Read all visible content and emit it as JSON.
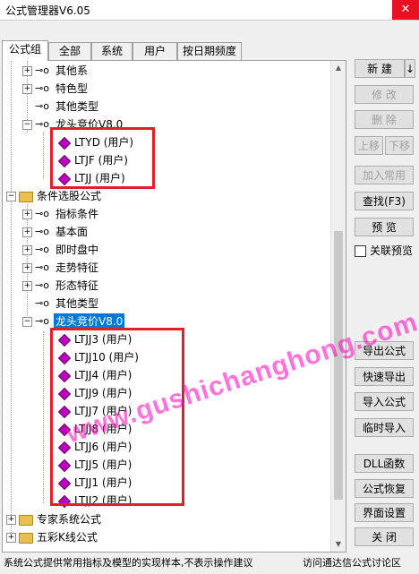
{
  "window": {
    "title": "公式管理器V6.05",
    "close": "✕"
  },
  "tabs": [
    "公式组",
    "全部",
    "系统",
    "用户",
    "按日期频度"
  ],
  "tree": {
    "top_items": [
      "其他系",
      "特色型",
      "其他类型",
      "龙头竞价V8.0"
    ],
    "group1_children": [
      "LTYD  (用户)",
      "LTJF  (用户)",
      "LTJJ  (用户)"
    ],
    "folder_condition": "条件选股公式",
    "condition_items": [
      "指标条件",
      "基本面",
      "即时盘中",
      "走势特征",
      "形态特征",
      "其他类型",
      "龙头竞价V8.0"
    ],
    "group2_children": [
      "LTJJ3  (用户)",
      "LTJJ10  (用户)",
      "LTJJ4  (用户)",
      "LTJJ9  (用户)",
      "LTJJ7  (用户)",
      "LTJJ8  (用户)",
      "LTJJ6  (用户)",
      "LTJJ5  (用户)",
      "LTJJ1  (用户)",
      "LTJJ2  (用户)"
    ],
    "folder_expert": "专家系统公式",
    "folder_kline": "五彩K线公式"
  },
  "buttons": {
    "new": "新 建",
    "new_arrow": "↓",
    "modify": "修 改",
    "delete": "删 除",
    "up": "上移",
    "down": "下移",
    "add_common": "加入常用",
    "find": "查找(F3)",
    "preview": "预 览",
    "link_preview": "关联预览",
    "export": "导出公式",
    "quick_export": "快速导出",
    "import": "导入公式",
    "temp_import": "临时导入",
    "dll": "DLL函数",
    "restore": "公式恢复",
    "ui_settings": "界面设置",
    "close": "关 闭"
  },
  "status": {
    "left": "系统公式提供常用指标及模型的实现样本,不表示操作建议",
    "right": "访问通达信公式讨论区"
  },
  "watermark": "www.gushichanghong.com"
}
